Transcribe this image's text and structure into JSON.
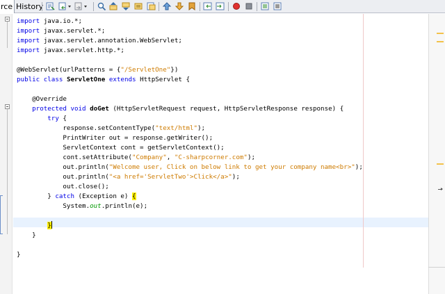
{
  "tabs": {
    "source": "rce",
    "history": "History"
  },
  "toolbar": {
    "icons": [
      "last-edit-icon",
      "back-icon",
      "back-dropdown-icon",
      "forward-icon",
      "forward-dropdown-icon",
      "find-selection-icon",
      "find-previous-icon",
      "find-next-icon",
      "toggle-highlight-icon",
      "toggle-rectangular-icon",
      "previous-bookmark-icon",
      "next-bookmark-icon",
      "toggle-bookmark-icon",
      "shift-left-icon",
      "shift-right-icon",
      "start-macro-icon",
      "stop-macro-icon",
      "comment-icon",
      "uncomment-icon"
    ],
    "colors": {
      "macro_record": "#e0312f",
      "stop": "#8a8f98"
    }
  },
  "editor": {
    "lines": [
      [
        [
          "kw",
          "import"
        ],
        [
          "",
          "java.io.*;"
        ]
      ],
      [
        [
          "kw",
          "import"
        ],
        [
          "",
          "javax.servlet.*;"
        ]
      ],
      [
        [
          "kw",
          "import"
        ],
        [
          "",
          "javax.servlet.annotation.WebServlet;"
        ]
      ],
      [
        [
          "kw",
          "import"
        ],
        [
          "",
          "javax.servlet.http.*;"
        ]
      ],
      [],
      [
        [
          "",
          "@WebServlet(urlPatterns = {"
        ],
        [
          "str",
          "\"/ServletOne\""
        ],
        [
          "",
          "})"
        ]
      ],
      [
        [
          "kw",
          "public class"
        ],
        [
          "",
          ""
        ],
        [
          "b",
          "ServletOne"
        ],
        [
          "",
          ""
        ],
        [
          "kw",
          "extends"
        ],
        [
          "",
          "HttpServlet {"
        ]
      ],
      [],
      [
        [
          "",
          "    @Override"
        ]
      ],
      [
        [
          "kw",
          "    protected void"
        ],
        [
          "",
          ""
        ],
        [
          "b",
          "doGet"
        ],
        [
          "",
          "(HttpServletRequest request, HttpServletResponse response) {"
        ]
      ],
      [
        [
          "kw",
          "        try"
        ],
        [
          "",
          "{"
        ]
      ],
      [
        [
          "",
          "            response.setContentType("
        ],
        [
          "str",
          "\"text/html\""
        ],
        [
          "",
          ");"
        ]
      ],
      [
        [
          "",
          "            PrintWriter out = response.getWriter();"
        ]
      ],
      [
        [
          "",
          "            ServletContext cont = getServletContext();"
        ]
      ],
      [
        [
          "",
          "            cont.setAttribute("
        ],
        [
          "str",
          "\"Company\""
        ],
        [
          "",
          ", "
        ],
        [
          "str",
          "\"C-sharpcorner.com\""
        ],
        [
          "",
          ");"
        ]
      ],
      [
        [
          "",
          "            out.println("
        ],
        [
          "str",
          "\"Welcome user, Click on below link to get your company name<br>\""
        ],
        [
          "",
          ");"
        ]
      ],
      [
        [
          "",
          "            out.println("
        ],
        [
          "str",
          "\"<a href='ServletTwo'>Click</a>\""
        ],
        [
          "",
          ");"
        ]
      ],
      [
        [
          "",
          "            out.close();"
        ]
      ],
      [
        [
          "",
          "        } "
        ],
        [
          "kw",
          "catch"
        ],
        [
          "",
          "(Exception e) "
        ],
        [
          "hl",
          "{"
        ]
      ],
      [
        [
          "",
          "            System."
        ],
        [
          "it",
          "out"
        ],
        [
          "",
          ".println(e);"
        ]
      ],
      [],
      [
        [
          "",
          "        "
        ],
        [
          "hl",
          "}"
        ],
        [
          "caret",
          ""
        ]
      ],
      [
        [
          "",
          "    }"
        ]
      ],
      [],
      [
        [
          "",
          "}"
        ]
      ]
    ]
  }
}
